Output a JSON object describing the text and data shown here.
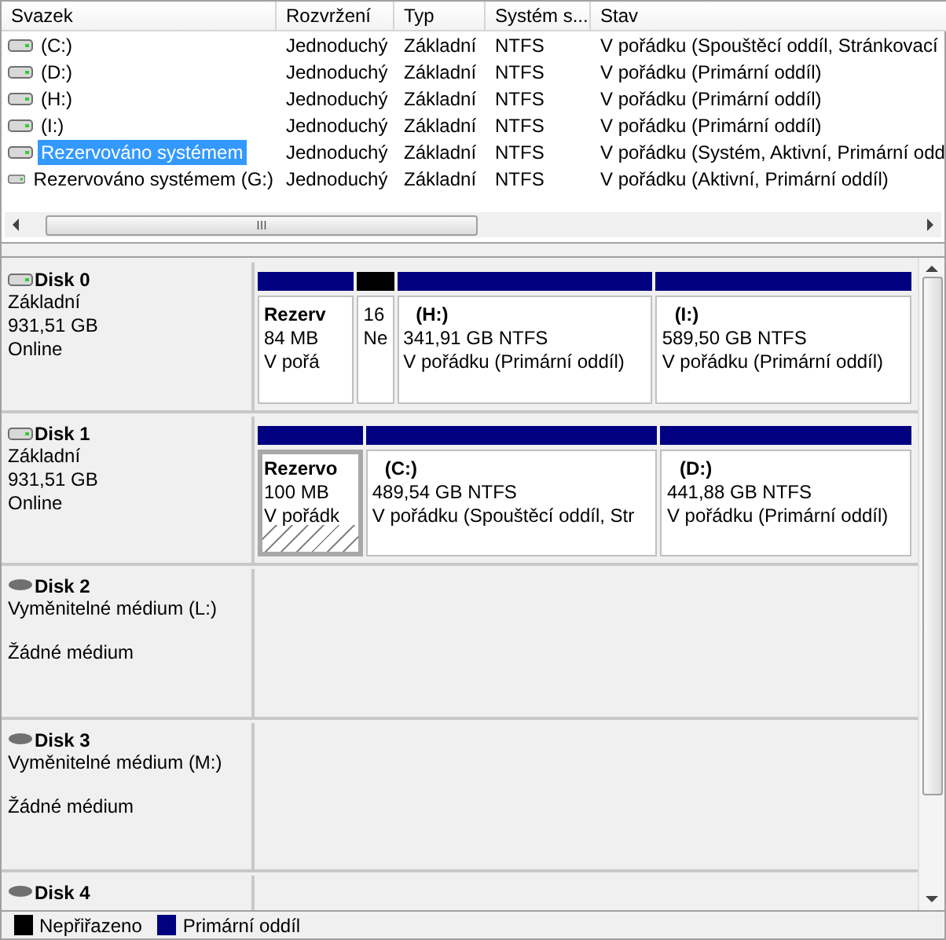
{
  "volume_table": {
    "columns": [
      "Svazek",
      "Rozvržení",
      "Typ",
      "Systém s...",
      "Stav"
    ],
    "rows": [
      {
        "name": "(C:)",
        "layout": "Jednoduchý",
        "type": "Základní",
        "file_system": "NTFS",
        "status": "V pořádku (Spouštěcí oddíl, Stránkovací",
        "selected": false
      },
      {
        "name": "(D:)",
        "layout": "Jednoduchý",
        "type": "Základní",
        "file_system": "NTFS",
        "status": "V pořádku (Primární oddíl)",
        "selected": false
      },
      {
        "name": "(H:)",
        "layout": "Jednoduchý",
        "type": "Základní",
        "file_system": "NTFS",
        "status": "V pořádku (Primární oddíl)",
        "selected": false
      },
      {
        "name": "(I:)",
        "layout": "Jednoduchý",
        "type": "Základní",
        "file_system": "NTFS",
        "status": "V pořádku (Primární oddíl)",
        "selected": false
      },
      {
        "name": "Rezervováno systémem",
        "layout": "Jednoduchý",
        "type": "Základní",
        "file_system": "NTFS",
        "status": "V pořádku (Systém, Aktivní, Primární odd",
        "selected": true
      },
      {
        "name": "Rezervováno systémem (G:)",
        "layout": "Jednoduchý",
        "type": "Základní",
        "file_system": "NTFS",
        "status": "V pořádku (Aktivní, Primární oddíl)",
        "selected": false
      }
    ],
    "scrollbar_grip": "III"
  },
  "disks": [
    {
      "kind": "fixed",
      "name": "Disk 0",
      "type": "Základní",
      "size": "931,51 GB",
      "state": "Online",
      "partitions": [
        {
          "kind": "primary",
          "name": "Rezerv",
          "size": "84 MB",
          "status": "V pořá",
          "selected": false
        },
        {
          "kind": "unallocated",
          "size": "16",
          "status": "Ne",
          "selected": false
        },
        {
          "kind": "primary",
          "name": "(H:)",
          "size": "341,91 GB NTFS",
          "status": "V pořádku (Primární oddíl)",
          "selected": false
        },
        {
          "kind": "primary",
          "name": "(I:)",
          "size": "589,50 GB NTFS",
          "status": "V pořádku (Primární oddíl)",
          "selected": false
        }
      ]
    },
    {
      "kind": "fixed",
      "name": "Disk 1",
      "type": "Základní",
      "size": "931,51 GB",
      "state": "Online",
      "partitions": [
        {
          "kind": "primary",
          "name": "Rezervo",
          "size": "100 MB",
          "status": "V pořádk",
          "selected": true
        },
        {
          "kind": "primary",
          "name": "(C:)",
          "size": "489,54 GB NTFS",
          "status": "V pořádku (Spouštěcí oddíl, Str",
          "selected": false
        },
        {
          "kind": "primary",
          "name": "(D:)",
          "size": "441,88 GB NTFS",
          "status": "V pořádku (Primární oddíl)",
          "selected": false
        }
      ]
    },
    {
      "kind": "removable",
      "name": "Disk 2",
      "type": "Vyměnitelné médium (L:)",
      "state": "Žádné médium"
    },
    {
      "kind": "removable",
      "name": "Disk 3",
      "type": "Vyměnitelné médium (M:)",
      "state": "Žádné médium"
    },
    {
      "kind": "removable",
      "name": "Disk 4"
    }
  ],
  "legend": [
    {
      "label": "Nepřiřazeno",
      "color": "#000000"
    },
    {
      "label": "Primární oddíl",
      "color": "#000080"
    }
  ]
}
